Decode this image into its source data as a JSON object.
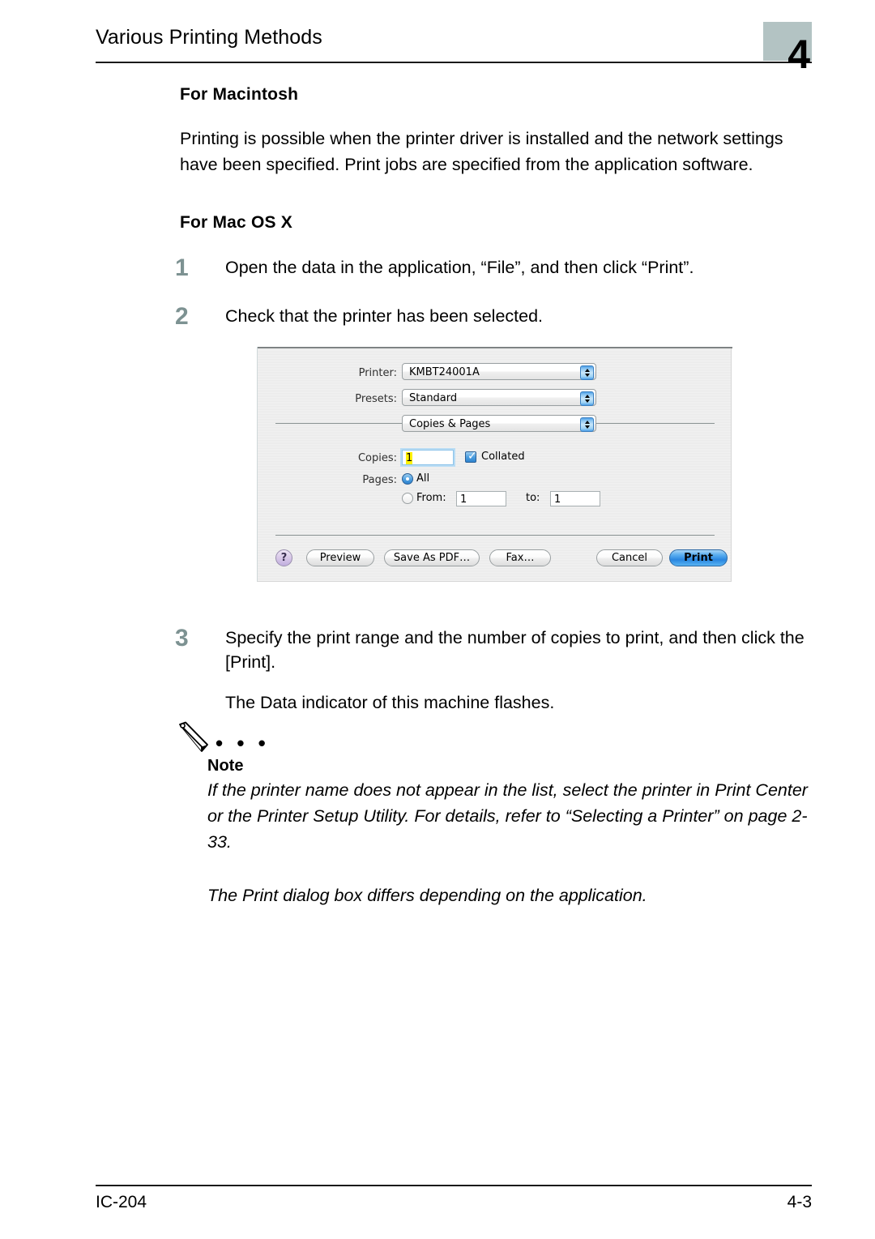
{
  "header": {
    "title": "Various Printing Methods",
    "chapter_number": "4"
  },
  "sections": {
    "macintosh_heading": "For Macintosh",
    "macintosh_body": "Printing is possible when the printer driver is installed and the network settings have been specified. Print jobs are specified from the application software.",
    "macosx_heading": "For Mac OS X"
  },
  "steps": [
    {
      "number": "1",
      "text": "Open the data in the application, “File”, and then click “Print”."
    },
    {
      "number": "2",
      "text": "Check that the printer has been selected."
    },
    {
      "number": "3",
      "text": "Specify the print range and the number of copies to print, and then click the [Print].",
      "sub_text": "The Data indicator of this machine flashes."
    }
  ],
  "print_dialog": {
    "printer_label": "Printer:",
    "printer_value": "KMBT24001A",
    "presets_label": "Presets:",
    "presets_value": "Standard",
    "pane_value": "Copies & Pages",
    "copies_label": "Copies:",
    "copies_value": "1",
    "collated_label": "Collated",
    "pages_label": "Pages:",
    "pages_all_label": "All",
    "pages_from_label": "From:",
    "pages_from_value": "1",
    "pages_to_label": "to:",
    "pages_to_value": "1",
    "help_label": "?",
    "preview_label": "Preview",
    "save_pdf_label": "Save As PDF…",
    "fax_label": "Fax…",
    "cancel_label": "Cancel",
    "print_label": "Print"
  },
  "note": {
    "dots": "• • •",
    "title": "Note",
    "body": "If the printer name does not appear in the list, select the printer in Print Center or the Printer Setup Utility. For details, refer to “Selecting a Printer” on page 2-33.",
    "body2": "The Print dialog box differs depending on the application."
  },
  "footer": {
    "left": "IC-204",
    "right": "4-3"
  }
}
